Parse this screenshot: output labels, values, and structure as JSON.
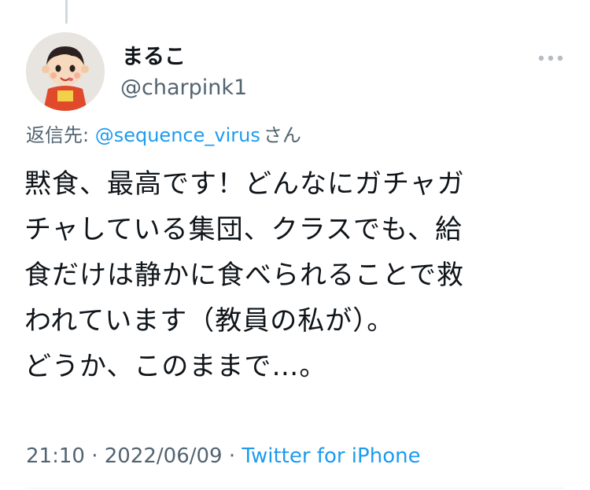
{
  "thread": {
    "connector": true
  },
  "author": {
    "display_name": "まるこ",
    "handle": "@charpink1",
    "avatar_icon": "doll-avatar-icon"
  },
  "reply": {
    "prefix": "返信先: ",
    "mention": "@sequence_virus",
    "suffix": "さん"
  },
  "tweet": {
    "lines": [
      "黙食、最高です！どんなにガチャガ",
      "チャしている集団、クラスでも、給",
      "食だけは静かに食べられることで救",
      "われています（教員の私が）。",
      "どうか、このままで…。"
    ]
  },
  "meta": {
    "time": "21:10",
    "separator1": " · ",
    "date": "2022/06/09",
    "separator2": " · ",
    "source": "Twitter for iPhone"
  },
  "colors": {
    "text": "#0f1419",
    "secondary": "#536471",
    "accent": "#1d9bf0"
  },
  "more_icon": "more-horizontal-icon"
}
